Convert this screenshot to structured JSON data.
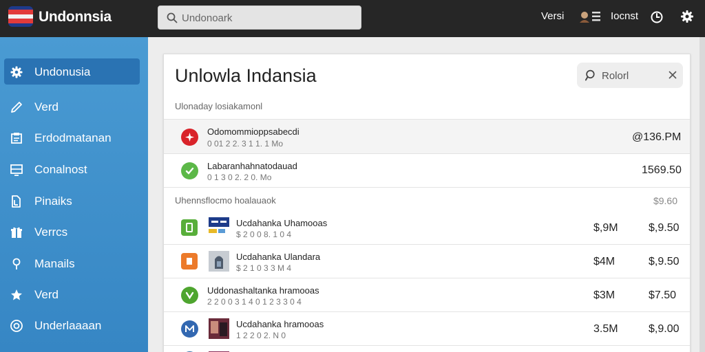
{
  "app": {
    "title": "Undonnsia"
  },
  "top_search": {
    "placeholder": "Undonoark"
  },
  "top_nav": {
    "link1": "Versi",
    "link2": "Iocnst"
  },
  "sidebar": {
    "items": [
      {
        "label": "Undonusia",
        "icon": "gear-icon"
      },
      {
        "label": "Verd",
        "icon": "pencil-icon"
      },
      {
        "label": "Erdodmatanan",
        "icon": "document-icon"
      },
      {
        "label": "Conalnost",
        "icon": "monitor-icon"
      },
      {
        "label": "Pinaiks",
        "icon": "files-icon"
      },
      {
        "label": "Verrcs",
        "icon": "gift-icon"
      },
      {
        "label": "Manails",
        "icon": "location-pin-icon"
      },
      {
        "label": "Verd",
        "icon": "star-icon"
      },
      {
        "label": "Underlaaaan",
        "icon": "target-icon"
      }
    ]
  },
  "main": {
    "title": "Unlowla Indansia",
    "search_placeholder": "Rolorl",
    "section1_label": "Ulonaday losiakamonl",
    "section2_label": "Uhennsflocmo hoalauaok",
    "section2_value": "$9.60",
    "rows": [
      {
        "title": "Odomommioppsabecdi",
        "sub": "0 01 2 2. 3 1 1. 1 Mo",
        "amount": "@136.PM",
        "icon": "red-badge-icon",
        "color": "#d9232a"
      },
      {
        "title": "Labaranhahnatodauad",
        "sub": "0 1 3 0 2. 2 0. Mo",
        "amount": "1569.50",
        "icon": "green-badge-icon",
        "color": "#5cb848"
      }
    ],
    "products": [
      {
        "title": "Ucdahanka Uhamooas",
        "sub": "$ 2 0 0 8. 1 0 4",
        "amount1": "$,9M",
        "amount2": "$,9.50",
        "icon": "green-square-icon",
        "color": "#58ae3a"
      },
      {
        "title": "Ucdahanka Ulandara",
        "sub": "$ 2 1 0 3 3 M 4",
        "amount1": "$4M",
        "amount2": "$,9.50",
        "icon": "orange-square-icon",
        "color": "#ec7a2a"
      },
      {
        "title": "Uddonashaltanka hramooas",
        "sub": "2 2 0 0 3 1 4 0 1 2 3 3 0 4",
        "amount1": "$3M",
        "amount2": "$7.50",
        "icon": "green-shield-icon",
        "color": "#4ea52f"
      },
      {
        "title": "Ucdahanka hramooas",
        "sub": "1 2 2 0 2. N 0",
        "amount1": "3.5M",
        "amount2": "$,9.00",
        "icon": "blue-circle-m-icon",
        "color": "#3368b1"
      }
    ]
  }
}
